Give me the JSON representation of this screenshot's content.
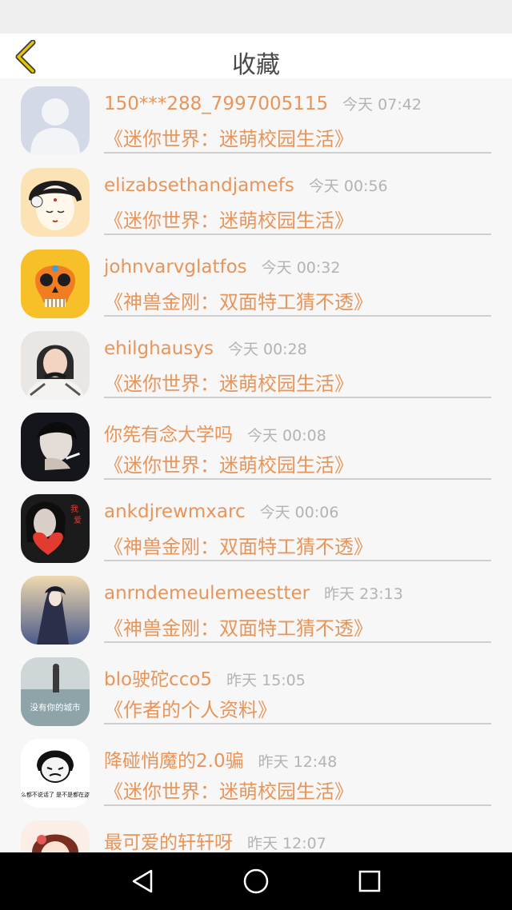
{
  "status_bar": {
    "left_text": "",
    "right_text": ""
  },
  "header": {
    "title": "收藏"
  },
  "items": [
    {
      "name": "150***288_7997005115",
      "time": "今天 07:42",
      "book": "《迷你世界：迷萌校园生活》",
      "avatar": "default-avatar"
    },
    {
      "name": "elizabsethandjamefs",
      "time": "今天 00:56",
      "book": "《迷你世界：迷萌校园生活》",
      "avatar": "geisha-avatar"
    },
    {
      "name": "johnvarvglatfos",
      "time": "今天 00:32",
      "book": "《神兽金刚：双面特工猜不透》",
      "avatar": "skull-avatar"
    },
    {
      "name": "ehilghausys",
      "time": "今天 00:28",
      "book": "《迷你世界：迷萌校园生活》",
      "avatar": "girl-photo-avatar"
    },
    {
      "name": "你筅有念大学吗",
      "time": "今天 00:08",
      "book": "《迷你世界：迷萌校园生活》",
      "avatar": "dark-photo-avatar"
    },
    {
      "name": "ankdjrewmxarc",
      "time": "今天 00:06",
      "book": "《神兽金刚：双面特工猜不透》",
      "avatar": "heart-photo-avatar"
    },
    {
      "name": "anrndemeulemeestter",
      "time": "昨天 23:13",
      "book": "《神兽金刚：双面特工猜不透》",
      "avatar": "anime-girl-avatar"
    },
    {
      "name": "blo驶砣cco5",
      "time": "昨天 15:05",
      "book": "《作者的个人资料》",
      "avatar": "city-photo-avatar",
      "avatar_text": "没有你的城市"
    },
    {
      "name": "降碰悄魔的2.0骗",
      "time": "昨天 12:48",
      "book": "《迷你世界：迷萌校园生活》",
      "avatar": "meme-avatar",
      "avatar_text": "怎么都不说话了 是不是都在盗梦"
    },
    {
      "name": "最可爱的轩轩呀",
      "time": "昨天 12:07",
      "book": "",
      "avatar": "cartoon-avatar"
    }
  ],
  "nav": {
    "back": "back-nav-icon",
    "home": "home-nav-icon",
    "recents": "recents-nav-icon"
  },
  "colors": {
    "accent": "#e7955a",
    "time": "#b3b3b3",
    "back_arrow": "#e6c400"
  }
}
